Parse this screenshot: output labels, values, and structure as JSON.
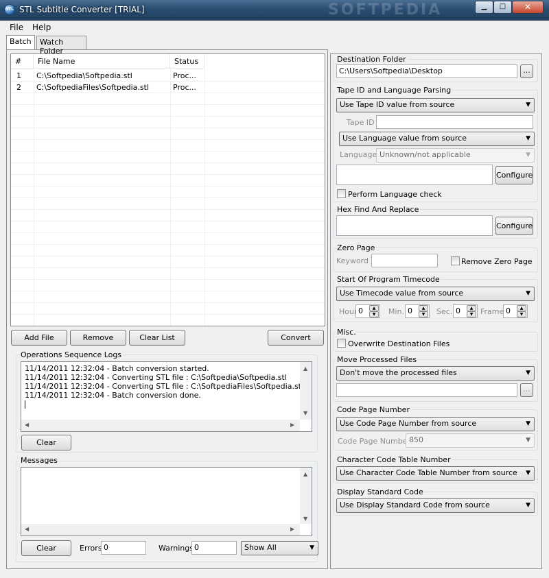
{
  "window": {
    "title": "STL Subtitle Converter [TRIAL]",
    "watermark": "SOFTPEDIA",
    "icon_text": "STL"
  },
  "menu": {
    "file": "File",
    "help": "Help"
  },
  "tabs": {
    "batch": "Batch",
    "watch": "Watch Folder"
  },
  "file_list": {
    "headers": {
      "num": "#",
      "file_name": "File Name",
      "status": "Status"
    },
    "rows": [
      {
        "num": "1",
        "file_name": "C:\\Softpedia\\Softpedia.stl",
        "status": "Proc..."
      },
      {
        "num": "2",
        "file_name": "C:\\SoftpediaFiles\\Softpedia.stl",
        "status": "Proc..."
      }
    ]
  },
  "buttons": {
    "add_file": "Add File",
    "remove": "Remove",
    "clear_list": "Clear List",
    "convert": "Convert"
  },
  "logs": {
    "title": "Operations Sequence Logs",
    "lines": [
      "11/14/2011 12:32:04 - Batch conversion started.",
      "11/14/2011 12:32:04 - Converting STL file : C:\\Softpedia\\Softpedia.stl",
      "11/14/2011 12:32:04 - Converting STL file : C:\\SoftpediaFiles\\Softpedia.stl",
      "11/14/2011 12:32:04 - Batch conversion done."
    ],
    "clear": "Clear"
  },
  "messages": {
    "title": "Messages",
    "clear": "Clear",
    "errors_label": "Errors",
    "errors_value": "0",
    "warnings_label": "Warnings",
    "warnings_value": "0",
    "filter": "Show All"
  },
  "destination": {
    "title": "Destination Folder",
    "value": "C:\\Users\\Softpedia\\Desktop",
    "browse": "..."
  },
  "tape": {
    "title": "Tape ID and Language Parsing",
    "tape_mode": "Use Tape ID value from source",
    "tape_id_label": "Tape ID",
    "lang_mode": "Use Language value from source",
    "language_label": "Language",
    "language_value": "Unknown/not applicable",
    "configure": "Configure",
    "perform_check": "Perform Language check"
  },
  "hex": {
    "title": "Hex Find And Replace",
    "configure": "Configure"
  },
  "zero_page": {
    "title": "Zero Page",
    "keyword_label": "Keyword",
    "remove_label": "Remove Zero Page"
  },
  "timecode": {
    "title": "Start Of Program Timecode",
    "mode": "Use Timecode value from source",
    "hour_label": "Hour",
    "hour": "0",
    "min_label": "Min.",
    "min": "0",
    "sec_label": "Sec.",
    "sec": "0",
    "frame_label": "Frame",
    "frame": "0"
  },
  "misc": {
    "title": "Misc.",
    "overwrite": "Overwrite Destination Files"
  },
  "move": {
    "title": "Move Processed Files",
    "mode": "Don't move the processed files",
    "browse": "..."
  },
  "code_page": {
    "title": "Code Page Number",
    "mode": "Use Code Page Number from source",
    "label": "Code Page Number",
    "value": "850"
  },
  "char_table": {
    "title": "Character Code Table Number",
    "mode": "Use Character Code Table Number from source"
  },
  "display_std": {
    "title": "Display Standard Code",
    "mode": "Use Display Standard Code from source"
  },
  "colors": {
    "title_bar": "#2a4e73",
    "window_bg": "#f0f0f0",
    "list_bg": "#ffffff"
  }
}
